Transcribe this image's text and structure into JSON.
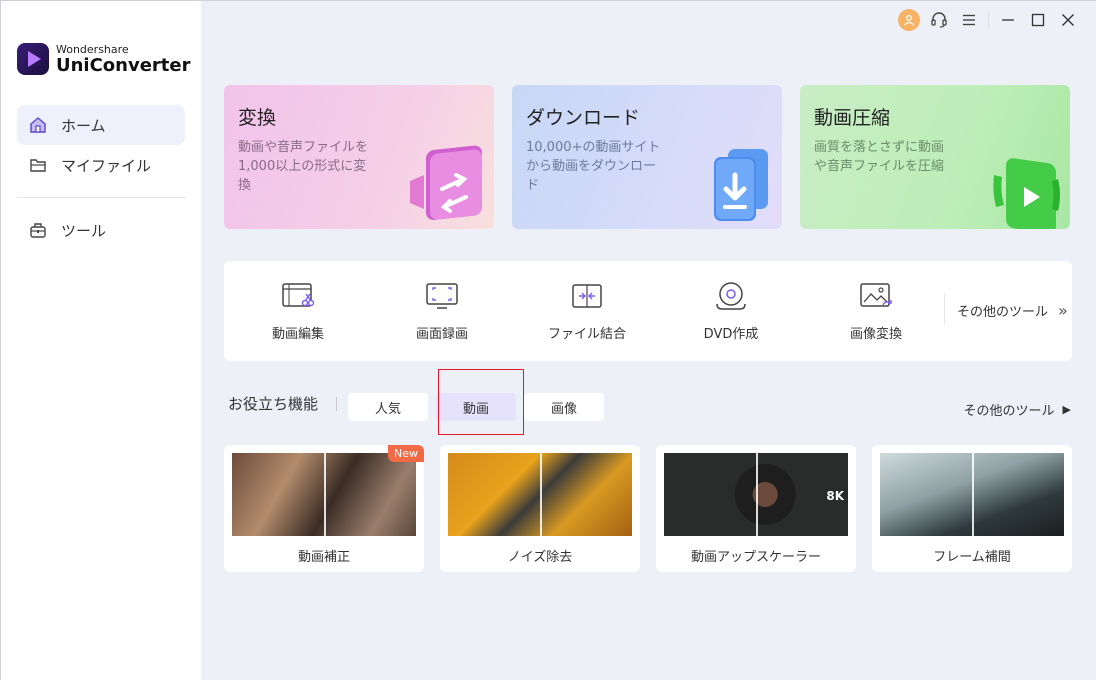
{
  "app": {
    "brand": "Wondershare",
    "name": "UniConverter"
  },
  "sidebar": {
    "items": [
      {
        "label": "ホーム",
        "icon": "home-icon",
        "active": true
      },
      {
        "label": "マイファイル",
        "icon": "folder-icon",
        "active": false
      },
      {
        "label": "ツール",
        "icon": "toolbox-icon",
        "active": false
      }
    ]
  },
  "titlebar": {
    "icons": [
      "user-avatar-icon",
      "headset-icon",
      "menu-icon",
      "minimize-icon",
      "maximize-icon",
      "close-icon"
    ]
  },
  "hero_cards": [
    {
      "title": "変換",
      "desc": "動画や音声ファイルを1,000以上の形式に変換"
    },
    {
      "title": "ダウンロード",
      "desc": "10,000+の動画サイトから動画をダウンロード"
    },
    {
      "title": "動画圧縮",
      "desc": "画質を落とさずに動画や音声ファイルを圧縮"
    }
  ],
  "tools": {
    "items": [
      {
        "label": "動画編集",
        "icon": "video-edit-icon"
      },
      {
        "label": "画面録画",
        "icon": "screen-record-icon"
      },
      {
        "label": "ファイル結合",
        "icon": "merge-icon"
      },
      {
        "label": "DVD作成",
        "icon": "dvd-icon"
      },
      {
        "label": "画像変換",
        "icon": "image-convert-icon"
      }
    ],
    "more_label": "その他のツール"
  },
  "features": {
    "title": "お役立ち機能",
    "tabs": [
      {
        "label": "人気",
        "active": false
      },
      {
        "label": "動画",
        "active": true
      },
      {
        "label": "画像",
        "active": false
      }
    ],
    "more_label": "その他のツール",
    "cards": [
      {
        "label": "動画補正",
        "badge": "New"
      },
      {
        "label": "ノイズ除去",
        "badge": ""
      },
      {
        "label": "動画アップスケーラー",
        "badge": "",
        "overlay": "8K"
      },
      {
        "label": "フレーム補間",
        "badge": ""
      }
    ]
  },
  "colors": {
    "accent": "#7b5cf0",
    "highlight_box": "#e0192d",
    "badge_new": "#f26a45"
  }
}
